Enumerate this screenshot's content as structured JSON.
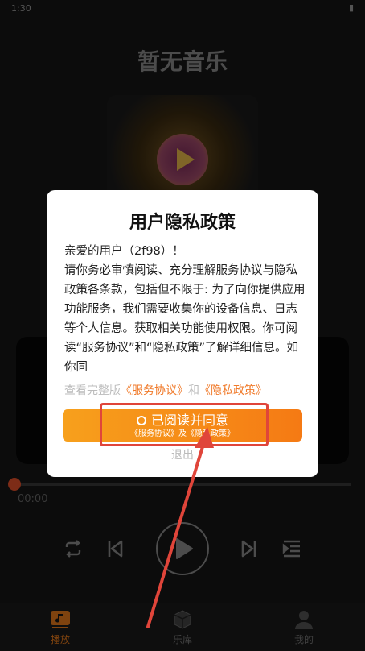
{
  "status_bar": {
    "time": "1:30",
    "icons": "▮"
  },
  "app_title": "暂无音乐",
  "player": {
    "current_time": "00:00"
  },
  "bottom_nav": {
    "items": [
      {
        "label": "播放",
        "icon": "music-note-icon",
        "active": true
      },
      {
        "label": "乐库",
        "icon": "cube-icon",
        "active": false
      },
      {
        "label": "我的",
        "icon": "user-icon",
        "active": false
      }
    ]
  },
  "dialog": {
    "title": "用户隐私政策",
    "greeting": "亲爱的用户（2f98）！",
    "body": "请你务必审慎阅读、充分理解服务协议与隐私政策各条款，包括但不限于: 为了向你提供应用功能服务，我们需要收集你的设备信息、日志等个人信息。获取相关功能使用权限。你可阅读“服务协议”和“隐私政策”了解详细信息。如你同",
    "view_prefix": "查看完整版",
    "service_link": "《服务协议》",
    "and_text": "和",
    "privacy_link": "《隐私政策》",
    "agree_label": "已阅读并同意",
    "agree_sub": "《服务协议》及《隐私政策》",
    "exit_label": "退出"
  },
  "colors": {
    "accent": "#f57a14",
    "highlight": "#e0453a",
    "background": "#161616"
  }
}
